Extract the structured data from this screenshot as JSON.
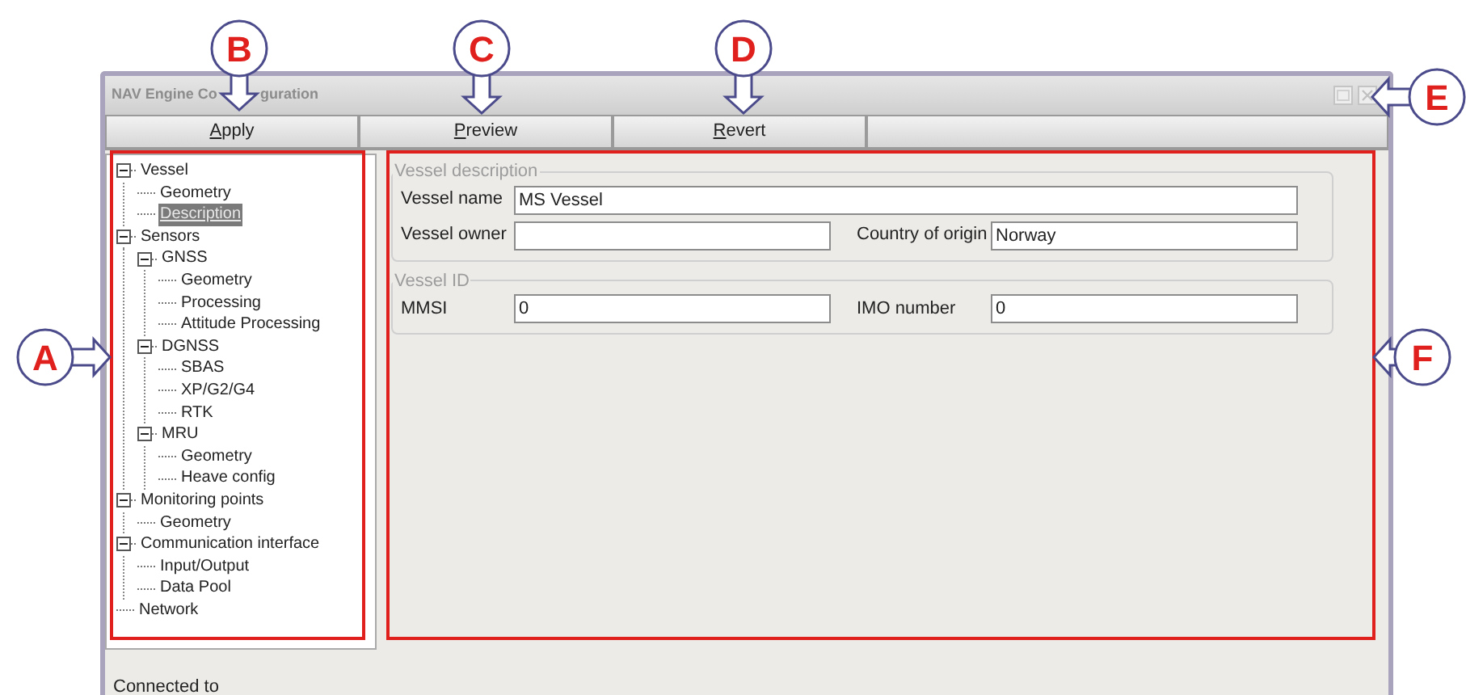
{
  "window": {
    "title_parts": [
      "NAV Engine Co",
      "guration"
    ]
  },
  "toolbar": [
    {
      "label": "Apply",
      "underline_first": true
    },
    {
      "label": "Preview",
      "underline_first": true
    },
    {
      "label": "Revert",
      "underline_first": true
    }
  ],
  "tree": [
    {
      "label": "Vessel",
      "expanded": true,
      "selected": false,
      "children": [
        {
          "label": "Geometry",
          "selected": false
        },
        {
          "label": "Description",
          "selected": true
        }
      ]
    },
    {
      "label": "Sensors",
      "expanded": true,
      "selected": false,
      "children": [
        {
          "label": "GNSS",
          "expanded": true,
          "selected": false,
          "children": [
            {
              "label": "Geometry",
              "selected": false
            },
            {
              "label": "Processing",
              "selected": false
            },
            {
              "label": "Attitude Processing",
              "selected": false
            }
          ]
        },
        {
          "label": "DGNSS",
          "expanded": true,
          "selected": false,
          "children": [
            {
              "label": "SBAS",
              "selected": false
            },
            {
              "label": "XP/G2/G4",
              "selected": false
            },
            {
              "label": "RTK",
              "selected": false
            }
          ]
        },
        {
          "label": "MRU",
          "expanded": true,
          "selected": false,
          "children": [
            {
              "label": "Geometry",
              "selected": false
            },
            {
              "label": "Heave config",
              "selected": false
            }
          ]
        }
      ]
    },
    {
      "label": "Monitoring points",
      "expanded": true,
      "selected": false,
      "children": [
        {
          "label": "Geometry",
          "selected": false
        }
      ]
    },
    {
      "label": "Communication interface",
      "expanded": true,
      "selected": false,
      "children": [
        {
          "label": "Input/Output",
          "selected": false
        },
        {
          "label": "Data Pool",
          "selected": false
        }
      ]
    },
    {
      "label": "Network",
      "selected": false
    }
  ],
  "groups": [
    {
      "title": "Vessel description",
      "fields": [
        {
          "kind": "wide",
          "label": "Vessel name",
          "value": "MS Vessel"
        },
        {
          "kind": "half",
          "label": "Vessel owner"
        },
        {
          "kind": "half",
          "label": "Country of origin",
          "value": "Norway"
        }
      ]
    },
    {
      "title": "Vessel ID",
      "fields": [
        {
          "kind": "half",
          "label": "MMSI",
          "value": "0"
        },
        {
          "kind": "half",
          "label": "IMO number",
          "value": "0"
        }
      ]
    }
  ],
  "status_bar": "Connected to",
  "callouts": [
    {
      "label": "B"
    },
    {
      "label": "C"
    },
    {
      "label": "D"
    },
    {
      "label": "E"
    },
    {
      "label": "A"
    },
    {
      "label": "F"
    }
  ]
}
